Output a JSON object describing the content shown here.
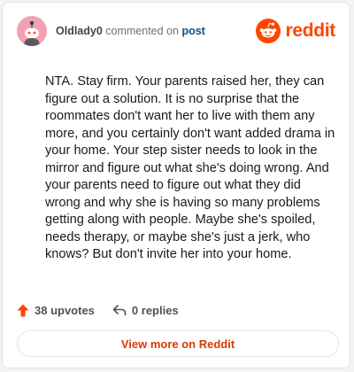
{
  "comment": {
    "username": "Oldlady0",
    "action_text": "commented on",
    "post_link": "post",
    "text": "NTA. Stay firm. Your parents raised her, they can figure out a solution. It is no surprise that the roommates don't want her to live with them any more, and you certainly don't want added drama in your home. Your step sister needs to look in the mirror and figure out what she's doing wrong. And your parents need to figure out what they did wrong and why she is having so many problems getting along with people. Maybe she's spoiled, needs therapy, or maybe she's just a jerk, who knows? But don't invite her into your home.",
    "upvotes": "38 upvotes",
    "replies": "0 replies"
  },
  "brand": {
    "wordmark": "reddit",
    "icon": "reddit-snoo-icon"
  },
  "cta": {
    "label": "View more on Reddit"
  },
  "colors": {
    "accent": "#ff4500",
    "cta_text": "#d93a00",
    "post_link": "#0b4f8c",
    "avatar_bg": "#f2a0b5"
  },
  "icons": {
    "upvote": "upvote-arrow-icon",
    "reply": "reply-arrow-icon",
    "avatar": "snoo-avatar-icon"
  }
}
